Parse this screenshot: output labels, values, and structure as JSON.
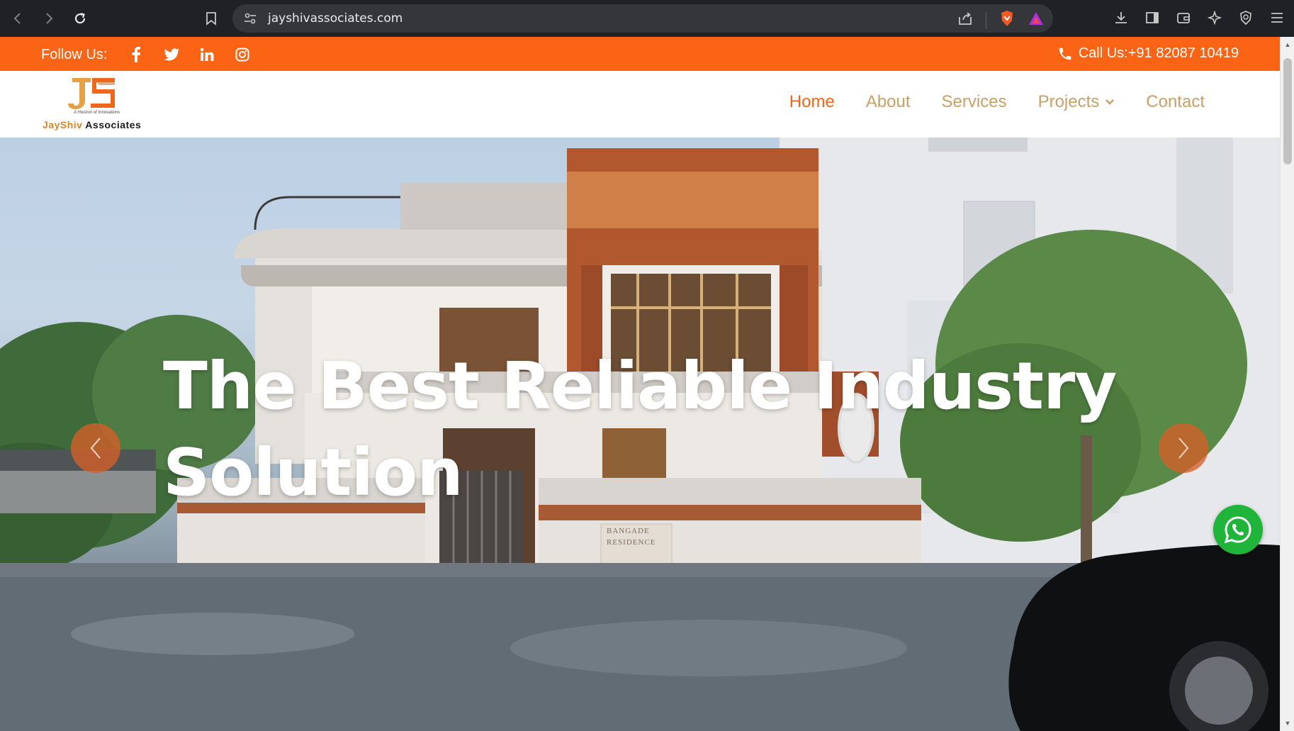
{
  "browser": {
    "url": "jayshivassociates.com",
    "icons": [
      "back-icon",
      "forward-icon",
      "reload-icon",
      "bookmark-icon",
      "site-settings-icon",
      "share-icon",
      "brave-shield-icon",
      "brave-rewards-icon",
      "download-icon",
      "sidebar-icon",
      "wallet-icon",
      "leo-ai-icon",
      "vpn-icon",
      "menu-icon"
    ]
  },
  "topbar": {
    "follow_label": "Follow Us:",
    "social": [
      "facebook-icon",
      "twitter-icon",
      "linkedin-icon",
      "instagram-icon"
    ],
    "call_label": "Call Us:+91 82087 10419",
    "color": "#fa6414"
  },
  "logo": {
    "brand_jay": "Jay",
    "brand_shiv": "Shiv",
    "brand_rest": " Associates",
    "tagline": "A Horizon of Innovations"
  },
  "nav": {
    "items": [
      {
        "label": "Home",
        "active": true
      },
      {
        "label": "About",
        "active": false
      },
      {
        "label": "Services",
        "active": false
      },
      {
        "label": "Projects",
        "active": false,
        "dropdown": true
      },
      {
        "label": "Contact",
        "active": false
      }
    ],
    "active_color": "#f0661b",
    "color": "#c9a067"
  },
  "hero": {
    "title_line1": "The Best Reliable Industry",
    "title_line2": "Solution",
    "plaque_line1": "BANGADE",
    "plaque_line2": "RESIDENCE"
  },
  "widgets": {
    "whatsapp": "whatsapp-icon",
    "prev": "chevron-left-icon",
    "next": "chevron-right-icon"
  }
}
